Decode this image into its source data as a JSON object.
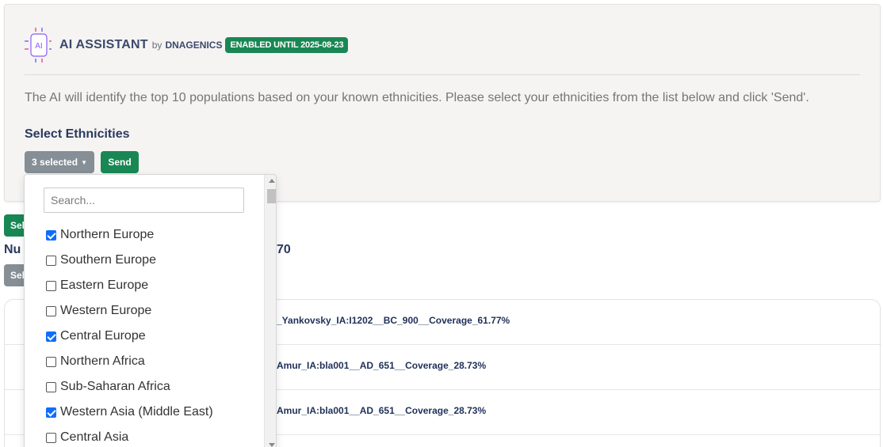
{
  "ai": {
    "title": "AI ASSISTANT",
    "by": "by",
    "by_name": "DNAGENICS",
    "badge": "ENABLED UNTIL 2025-08-23",
    "icon_text": "AI",
    "description": "The AI will identify the top 10 populations based on your known ethnicities. Please select your ethnicities from the list below and click 'Send'.",
    "select_label": "Select Ethnicities",
    "selected_button": "3 selected",
    "send_button": "Send"
  },
  "background": {
    "green_button": "Sel",
    "number_label": "Nu",
    "number_value": "70",
    "gray_button": "Sel",
    "results": [
      "_Yankovsky_IA:I1202__BC_900__Coverage_61.77%",
      "Amur_IA:bla001__AD_651__Coverage_28.73%",
      "Amur_IA:bla001__AD_651__Coverage_28.73%"
    ]
  },
  "dropdown": {
    "search_placeholder": "Search...",
    "items": [
      {
        "label": "Northern Europe",
        "checked": true
      },
      {
        "label": "Southern Europe",
        "checked": false
      },
      {
        "label": "Eastern Europe",
        "checked": false
      },
      {
        "label": "Western Europe",
        "checked": false
      },
      {
        "label": "Central Europe",
        "checked": true
      },
      {
        "label": "Northern Africa",
        "checked": false
      },
      {
        "label": "Sub-Saharan Africa",
        "checked": false
      },
      {
        "label": "Western Asia (Middle East)",
        "checked": true
      },
      {
        "label": "Central Asia",
        "checked": false
      }
    ]
  },
  "colors": {
    "primary_green": "#198754",
    "secondary_gray": "#868e96",
    "heading_navy": "#2a3a5e",
    "checkbox_blue": "#0d6efd"
  }
}
